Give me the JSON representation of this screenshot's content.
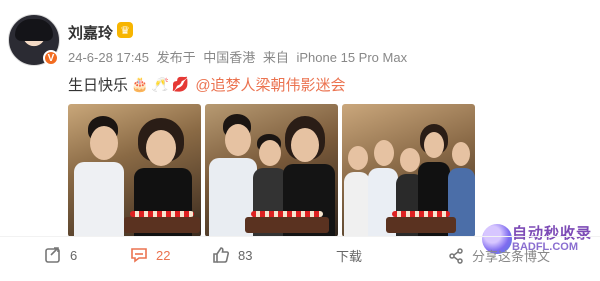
{
  "post": {
    "username": "刘嘉玲",
    "date": "24-6-28 17:45",
    "source_prefix": "发布于",
    "location": "中国香港",
    "device_prefix": "来自",
    "device": "iPhone 15 Pro Max",
    "text": "生日快乐",
    "emojis": [
      "cake-emoji",
      "cheers-emoji",
      "lips-emoji"
    ],
    "mention": "@追梦人梁朝伟影迷会"
  },
  "actions": {
    "repost_count": "6",
    "comment_count": "22",
    "like_count": "83",
    "download_label": "下载",
    "share_label": "分享这条博文"
  },
  "watermark": {
    "title": "自动秒收录",
    "url": "BADFL.COM"
  },
  "colors": {
    "accent": "#eb7350",
    "text": "#333333",
    "meta": "#888888",
    "vip": "#f26c21"
  }
}
